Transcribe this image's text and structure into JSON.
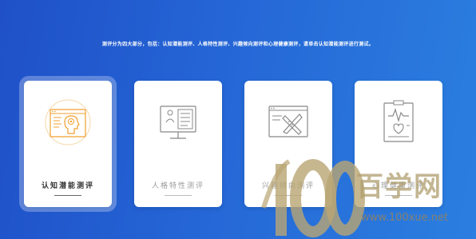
{
  "intro_text": "测评分为四大部分，包括：认知潜能测评、人格特性测评、兴趣倾向测评和心理健康测评，请单击认知潜能测评进行测试。",
  "cards": [
    {
      "label": "认知潜能测评",
      "icon": "brain-head-icon",
      "selected": true
    },
    {
      "label": "人格特性测评",
      "icon": "monitor-person-icon",
      "selected": false
    },
    {
      "label": "兴趣倾向测评",
      "icon": "pencil-ruler-icon",
      "selected": false
    },
    {
      "label": "心理健康测评",
      "icon": "health-report-icon",
      "selected": false
    }
  ],
  "watermark": {
    "number": "100",
    "text": "百学网",
    "url": "www.100xue.net"
  },
  "colors": {
    "accent": "#f0a030",
    "background_start": "#1f50c8",
    "background_end": "#2b7fe0"
  }
}
